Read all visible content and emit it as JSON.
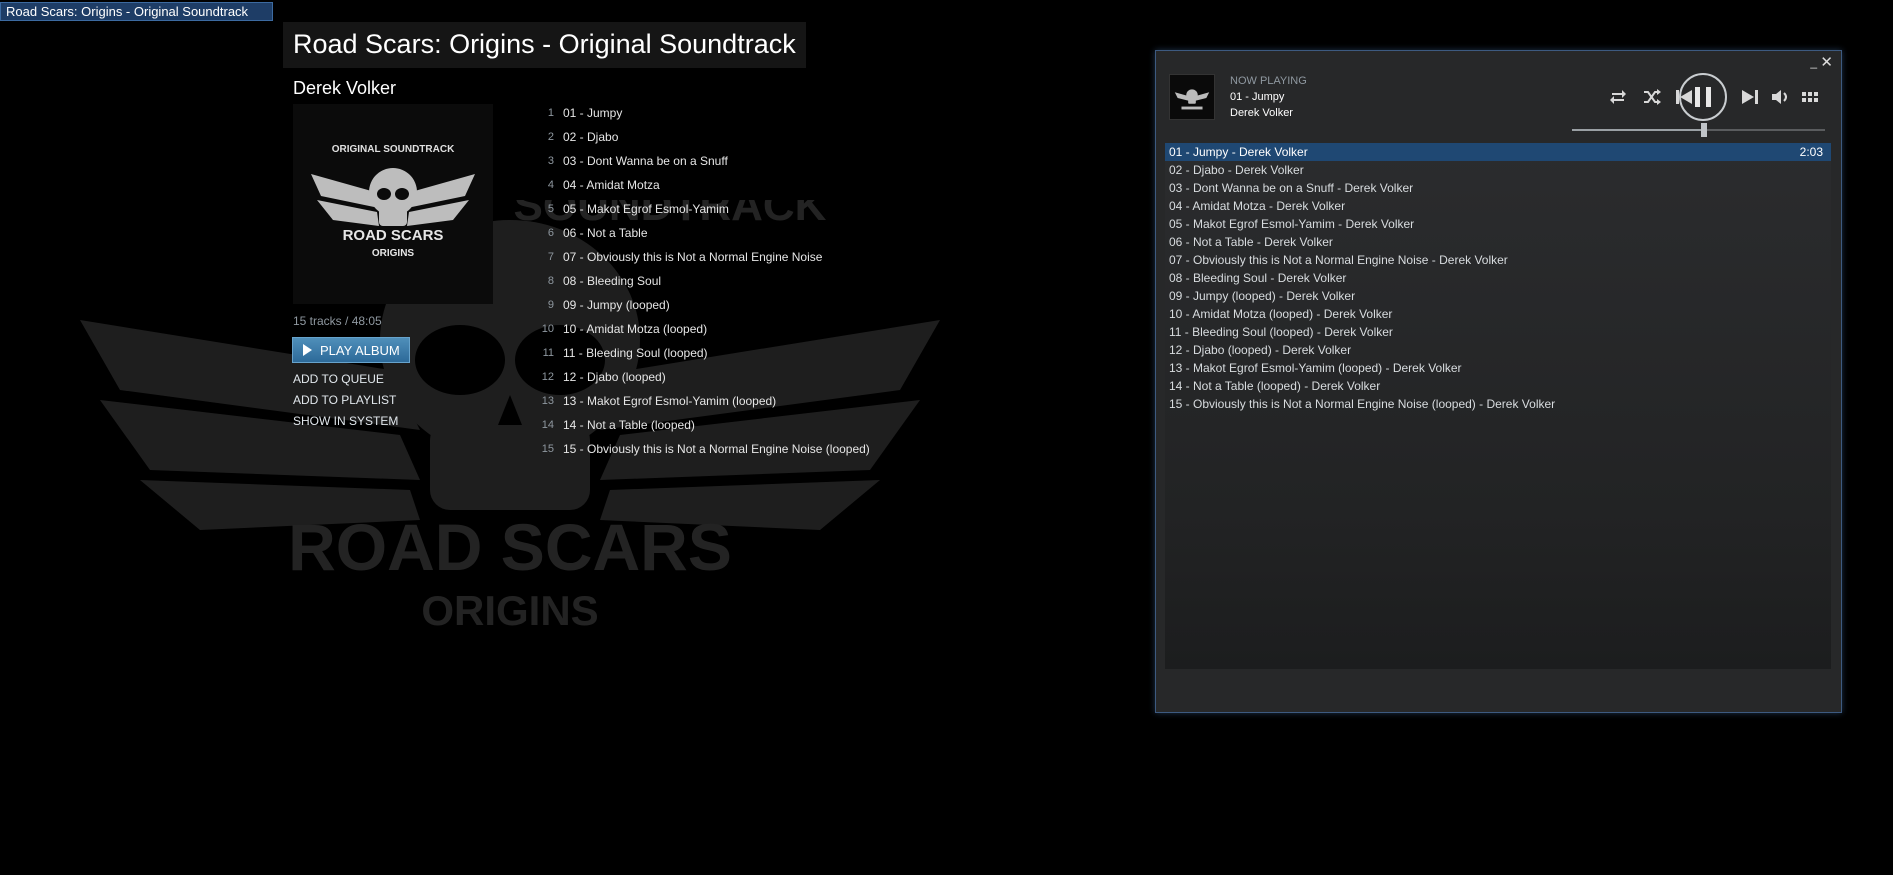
{
  "os_tab": {
    "title": "Road Scars: Origins - Original Soundtrack"
  },
  "album": {
    "title": "Road Scars: Origins - Original Soundtrack",
    "artist": "Derek Volker",
    "cover_text": {
      "top": "ORIGINAL SOUNDTRACK",
      "brand": "ROAD SCARS",
      "sub": "ORIGINS"
    },
    "background_text": {
      "top": "SOUNDTRACK",
      "brand": "ROAD SCARS",
      "sub": "ORIGINS"
    },
    "track_count": "15 tracks / 48:05",
    "play_album_label": "PLAY ALBUM",
    "links": {
      "add_to_queue": "ADD TO QUEUE",
      "add_to_playlist": "ADD TO PLAYLIST",
      "show_in_system": "SHOW IN SYSTEM"
    },
    "tracks": [
      {
        "num": "1",
        "title": "01 -  Jumpy"
      },
      {
        "num": "2",
        "title": "02 - Djabo"
      },
      {
        "num": "3",
        "title": "03 - Dont Wanna be on a Snuff"
      },
      {
        "num": "4",
        "title": "04 - Amidat Motza"
      },
      {
        "num": "5",
        "title": "05 - Makot Egrof Esmol-Yamim"
      },
      {
        "num": "6",
        "title": "06 - Not a Table"
      },
      {
        "num": "7",
        "title": "07 - Obviously this is Not a Normal Engine Noise"
      },
      {
        "num": "8",
        "title": "08 - Bleeding Soul"
      },
      {
        "num": "9",
        "title": "09 - Jumpy (looped)"
      },
      {
        "num": "10",
        "title": "10 - Amidat Motza (looped)"
      },
      {
        "num": "11",
        "title": "11 - Bleeding Soul (looped)"
      },
      {
        "num": "12",
        "title": "12 - Djabo (looped)"
      },
      {
        "num": "13",
        "title": "13 - Makot Egrof Esmol-Yamim (looped)"
      },
      {
        "num": "14",
        "title": "14 - Not a Table (looped)"
      },
      {
        "num": "15",
        "title": "15 - Obviously this is Not a Normal Engine Noise (looped)"
      }
    ]
  },
  "player": {
    "window_buttons": {
      "minimize": "_",
      "close": "✕"
    },
    "now_playing_label": "NOW PLAYING",
    "track": "01 -  Jumpy",
    "artist": "Derek Volker",
    "seek_fraction": 0.52,
    "icons": [
      "repeat-icon",
      "shuffle-icon",
      "previous-icon",
      "pause-icon",
      "next-icon",
      "volume-icon",
      "grid-menu-icon"
    ],
    "queue": [
      {
        "title": "01 -  Jumpy - Derek Volker",
        "duration": "2:03",
        "active": true
      },
      {
        "title": "02 - Djabo - Derek Volker",
        "duration": ""
      },
      {
        "title": "03 - Dont Wanna be on a Snuff - Derek Volker",
        "duration": ""
      },
      {
        "title": "04 - Amidat Motza - Derek Volker",
        "duration": ""
      },
      {
        "title": "05 - Makot Egrof Esmol-Yamim - Derek Volker",
        "duration": ""
      },
      {
        "title": "06 - Not a Table - Derek Volker",
        "duration": ""
      },
      {
        "title": "07 - Obviously this is Not a Normal Engine Noise - Derek Volker",
        "duration": ""
      },
      {
        "title": "08 - Bleeding Soul - Derek Volker",
        "duration": ""
      },
      {
        "title": "09 - Jumpy (looped) - Derek Volker",
        "duration": ""
      },
      {
        "title": "10 - Amidat Motza (looped) - Derek Volker",
        "duration": ""
      },
      {
        "title": "11 - Bleeding Soul (looped) - Derek Volker",
        "duration": ""
      },
      {
        "title": "12 - Djabo (looped) - Derek Volker",
        "duration": ""
      },
      {
        "title": "13 - Makot Egrof Esmol-Yamim (looped) - Derek Volker",
        "duration": ""
      },
      {
        "title": "14 - Not a Table (looped) - Derek Volker",
        "duration": ""
      },
      {
        "title": "15 - Obviously this is Not a Normal Engine Noise (looped) - Derek Volker",
        "duration": ""
      }
    ]
  },
  "colors": {
    "accent": "#1f4873",
    "button": "#3d7fae",
    "window_border": "#3d5a80"
  }
}
